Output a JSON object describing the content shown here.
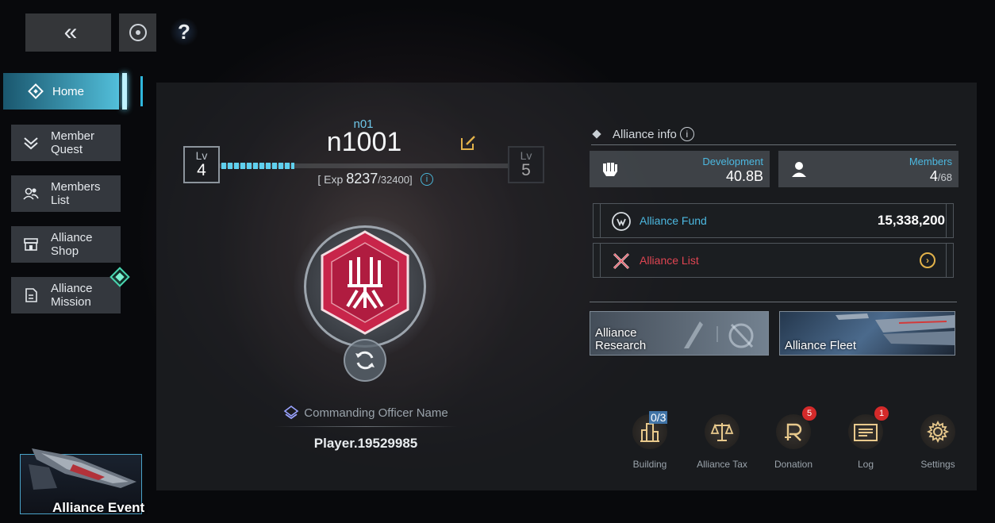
{
  "top_bar": {
    "back_icon": "double-chevron-left-icon",
    "back_glyph": "«",
    "target_icon": "target-icon",
    "help_glyph": "?"
  },
  "sidebar": {
    "items": [
      {
        "label": "Home",
        "icon": "diamond-icon",
        "active": true
      },
      {
        "label": "Member\nQuest",
        "icon": "chevrons-down-icon",
        "glyph": "⩔"
      },
      {
        "label": "Members\nList",
        "icon": "users-icon",
        "glyph": "👥"
      },
      {
        "label": "Alliance\nShop",
        "icon": "shop-icon",
        "glyph": "⊟"
      },
      {
        "label": "Alliance\nMission",
        "icon": "document-icon",
        "glyph": "🗎"
      }
    ]
  },
  "event": {
    "label": "Alliance Event"
  },
  "alliance": {
    "tag": "n01",
    "name": "n1001",
    "level_label": "Lv",
    "level_current": "4",
    "level_next": "5",
    "exp_prefix": "[ Exp ",
    "exp_current": "8237",
    "exp_max": "/32400]",
    "exp_progress": 0.254,
    "info_glyph": "i"
  },
  "officer": {
    "label": "Commanding Officer Name",
    "name": "Player.19529985"
  },
  "info": {
    "heading": "Alliance info",
    "info_glyph": "i",
    "development_label": "Development",
    "development_value": "40.8B",
    "members_label": "Members",
    "members_value": "4",
    "members_max": "/68",
    "fund_label": "Alliance Fund",
    "fund_value": "15,338,200",
    "list_label": "Alliance List",
    "list_arrow": "›"
  },
  "cards": {
    "research": "Alliance\nResearch",
    "fleet": "Alliance Fleet"
  },
  "tools": [
    {
      "label": "Building",
      "icon": "building-icon",
      "count": "0/3"
    },
    {
      "label": "Alliance Tax",
      "icon": "scales-icon"
    },
    {
      "label": "Donation",
      "icon": "donation-icon",
      "badge": "5"
    },
    {
      "label": "Log",
      "icon": "log-icon",
      "badge": "1"
    },
    {
      "label": "Settings",
      "icon": "gear-icon"
    }
  ],
  "colors": {
    "accent": "#4cb8e0",
    "emblem": "#c8254a",
    "alert": "#e04552",
    "gold": "#e2b24a"
  }
}
